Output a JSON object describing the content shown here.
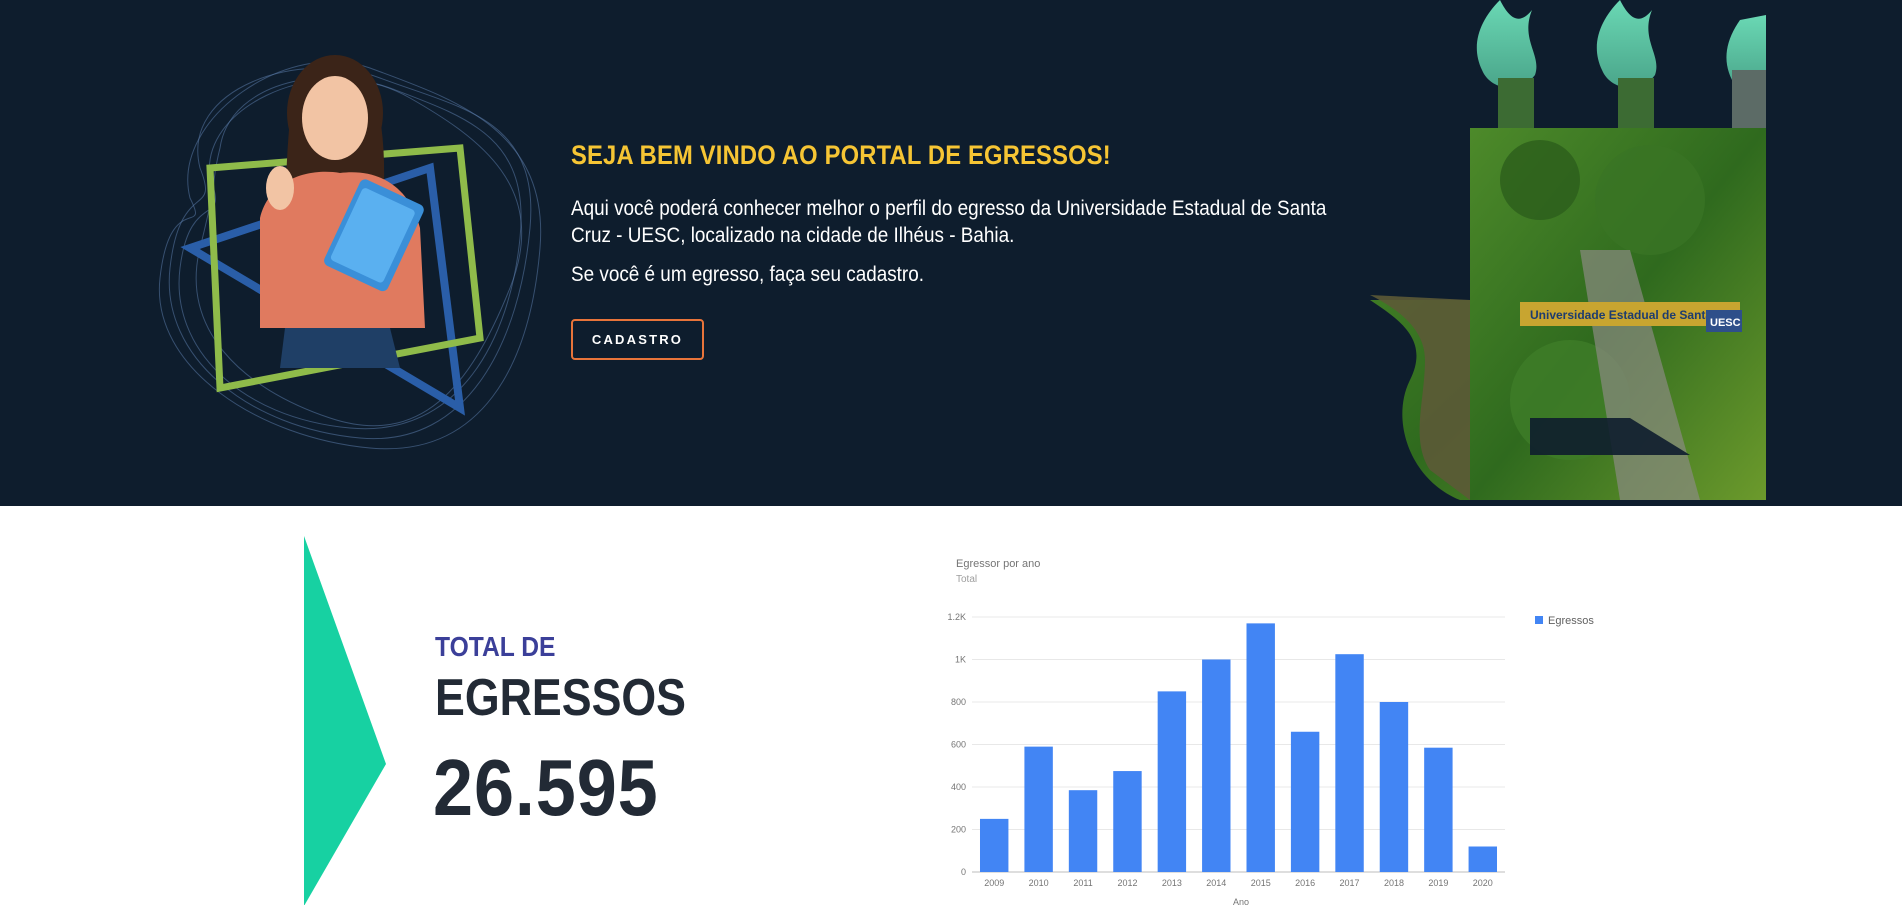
{
  "hero": {
    "title": "SEJA BEM VINDO AO PORTAL DE EGRESSOS!",
    "description": "Aqui você poderá conhecer melhor o perfil do egresso da Universidade Estadual de Santa Cruz - UESC, localizado na cidade de Ilhéus - Bahia.",
    "cta_text": "Se você é um egresso, faça seu cadastro.",
    "button_label": "CADASTRO",
    "campus_sign": "Universidade Estadual de Santa Cruz",
    "campus_sign_short": "UESC"
  },
  "stats": {
    "label": "TOTAL DE",
    "title": "EGRESSOS",
    "value": "26.595"
  },
  "colors": {
    "hero_bg": "#0e1d2d",
    "title_yellow": "#f6c534",
    "button_border": "#e8743a",
    "accent_teal": "#17d1a2",
    "label_indigo": "#3b3f99",
    "bar_blue": "#4285f4"
  },
  "chart_data": {
    "type": "bar",
    "title": "Egressor por ano",
    "subtitle": "Total",
    "xlabel": "Ano",
    "ylabel": "",
    "categories": [
      "2009",
      "2010",
      "2011",
      "2012",
      "2013",
      "2014",
      "2015",
      "2016",
      "2017",
      "2018",
      "2019",
      "2020"
    ],
    "series": [
      {
        "name": "Egressos",
        "values": [
          250,
          590,
          385,
          475,
          850,
          1000,
          1170,
          660,
          1025,
          800,
          585,
          120
        ]
      }
    ],
    "ylim": [
      0,
      1200
    ],
    "y_ticks": [
      0,
      200,
      400,
      600,
      800,
      1000,
      1200
    ],
    "y_tick_labels": [
      "0",
      "200",
      "400",
      "600",
      "800",
      "1K",
      "1.2K"
    ],
    "grid": true,
    "legend": "right"
  }
}
